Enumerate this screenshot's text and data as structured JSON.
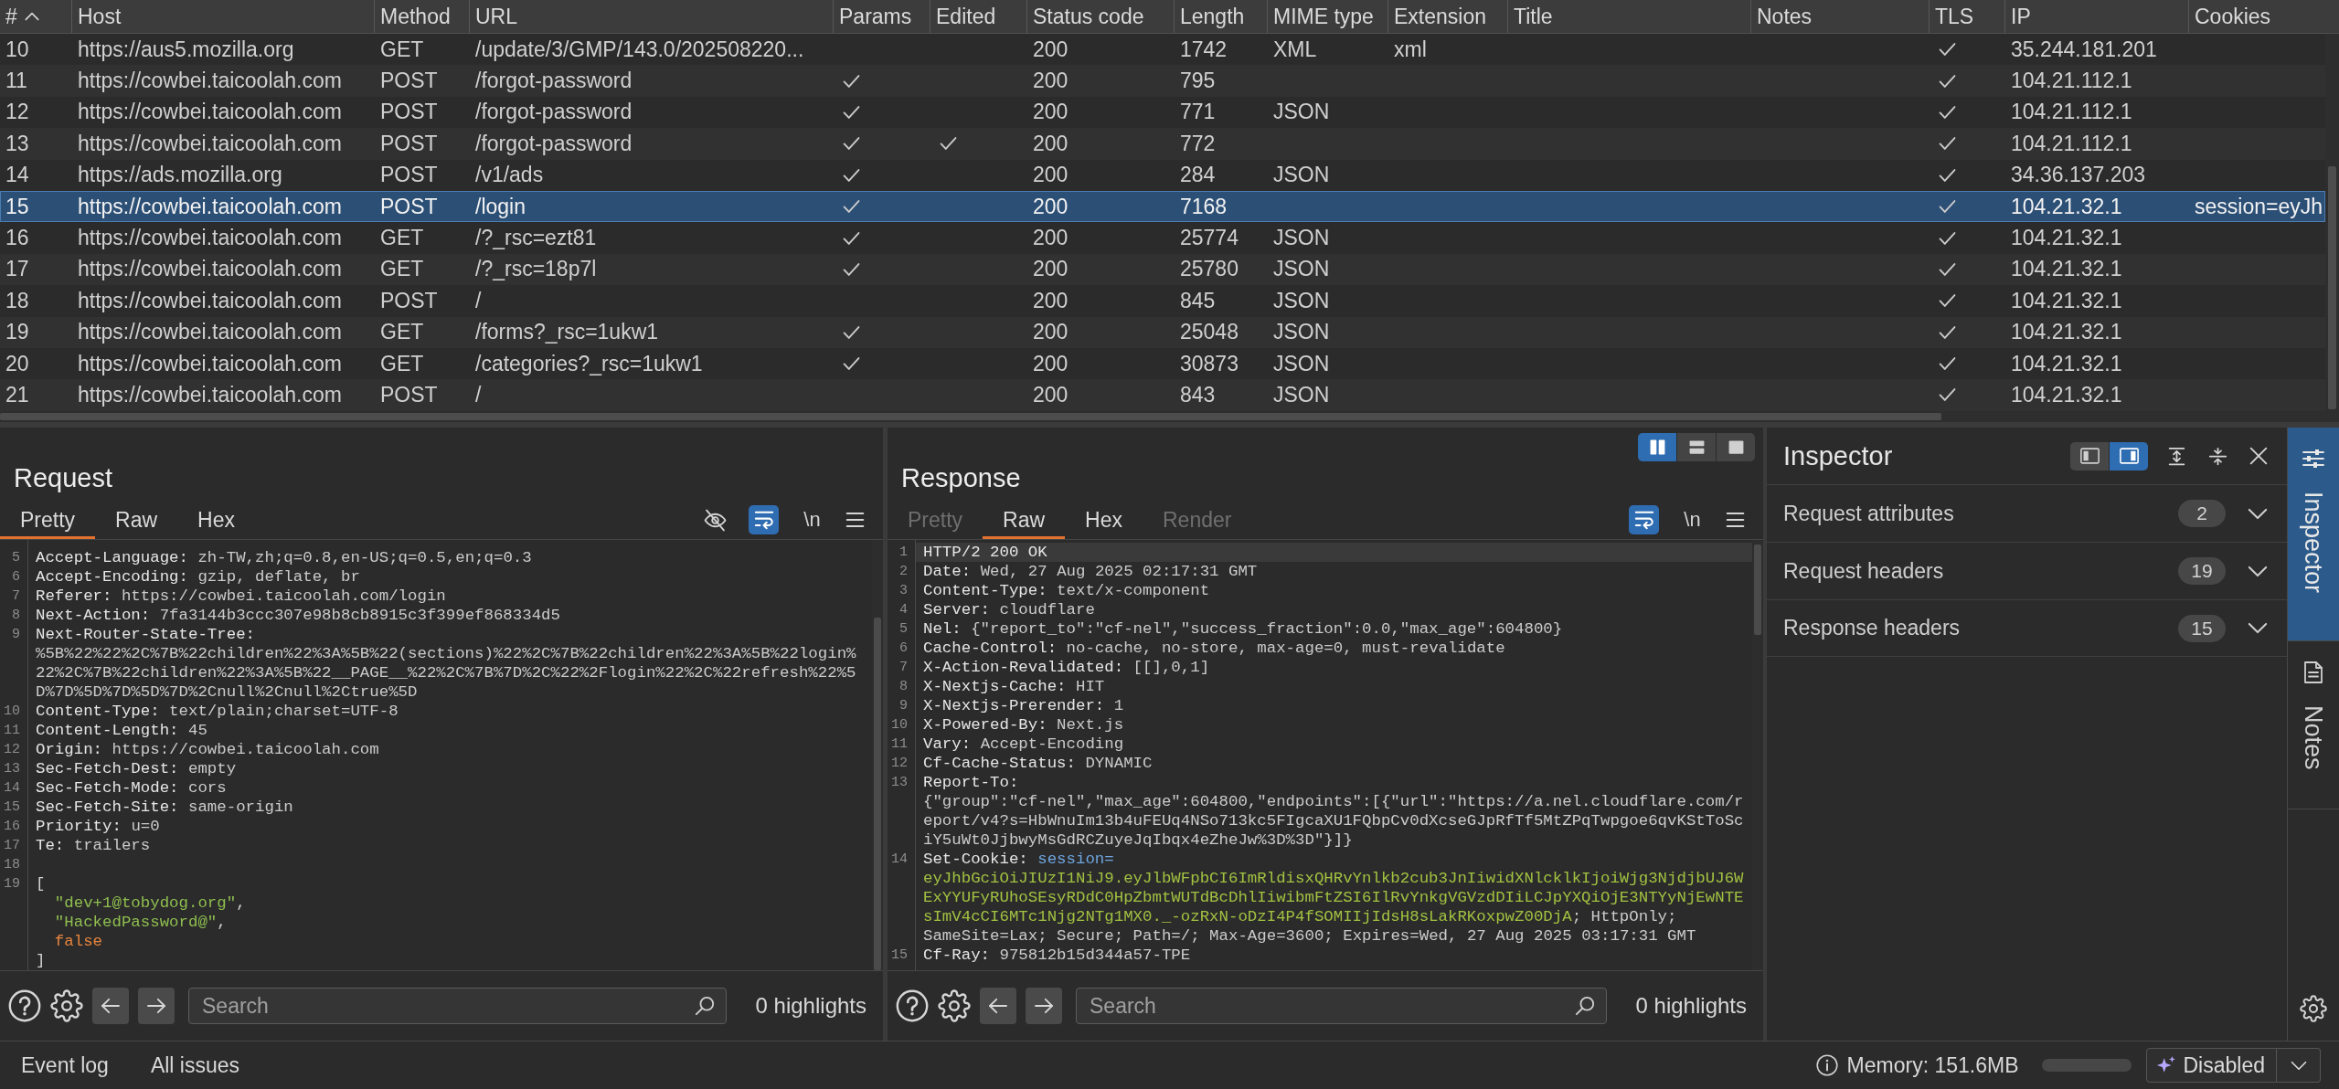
{
  "table": {
    "columns": [
      {
        "label": "#",
        "sorted": true
      },
      {
        "label": "Host",
        "sorted": false
      },
      {
        "label": "Method",
        "sorted": false
      },
      {
        "label": "URL",
        "sorted": false
      },
      {
        "label": "Params",
        "sorted": false
      },
      {
        "label": "Edited",
        "sorted": false
      },
      {
        "label": "Status code",
        "sorted": false
      },
      {
        "label": "Length",
        "sorted": false
      },
      {
        "label": "MIME type",
        "sorted": false
      },
      {
        "label": "Extension",
        "sorted": false
      },
      {
        "label": "Title",
        "sorted": false
      },
      {
        "label": "Notes",
        "sorted": false
      },
      {
        "label": "TLS",
        "sorted": false
      },
      {
        "label": "IP",
        "sorted": false
      },
      {
        "label": "Cookies",
        "sorted": false
      }
    ],
    "rows": [
      {
        "number": "10",
        "host": "https://aus5.mozilla.org",
        "method": "GET",
        "url": "/update/3/GMP/143.0/202508220...",
        "params": false,
        "edited": false,
        "status_code": "200",
        "length": "1742",
        "mime_type": "XML",
        "extension": "xml",
        "tls": true,
        "ip": "35.244.181.201",
        "selected": false
      },
      {
        "number": "11",
        "host": "https://cowbei.taicoolah.com",
        "method": "POST",
        "url": "/forgot-password",
        "params": true,
        "edited": false,
        "status_code": "200",
        "length": "795",
        "tls": true,
        "ip": "104.21.112.1",
        "selected": false
      },
      {
        "number": "12",
        "host": "https://cowbei.taicoolah.com",
        "method": "POST",
        "url": "/forgot-password",
        "params": true,
        "edited": false,
        "status_code": "200",
        "length": "771",
        "mime_type": "JSON",
        "tls": true,
        "ip": "104.21.112.1",
        "selected": false
      },
      {
        "number": "13",
        "host": "https://cowbei.taicoolah.com",
        "method": "POST",
        "url": "/forgot-password",
        "params": true,
        "edited": true,
        "status_code": "200",
        "length": "772",
        "tls": true,
        "ip": "104.21.112.1",
        "selected": false
      },
      {
        "number": "14",
        "host": "https://ads.mozilla.org",
        "method": "POST",
        "url": "/v1/ads",
        "params": true,
        "edited": false,
        "status_code": "200",
        "length": "284",
        "mime_type": "JSON",
        "tls": true,
        "ip": "34.36.137.203",
        "selected": false
      },
      {
        "number": "15",
        "host": "https://cowbei.taicoolah.com",
        "method": "POST",
        "url": "/login",
        "params": true,
        "edited": false,
        "status_code": "200",
        "length": "7168",
        "tls": true,
        "ip": "104.21.32.1",
        "cookies": "session=eyJh",
        "selected": true
      },
      {
        "number": "16",
        "host": "https://cowbei.taicoolah.com",
        "method": "GET",
        "url": "/?_rsc=ezt81",
        "params": true,
        "edited": false,
        "status_code": "200",
        "length": "25774",
        "mime_type": "JSON",
        "tls": true,
        "ip": "104.21.32.1",
        "selected": false
      },
      {
        "number": "17",
        "host": "https://cowbei.taicoolah.com",
        "method": "GET",
        "url": "/?_rsc=18p7l",
        "params": true,
        "edited": false,
        "status_code": "200",
        "length": "25780",
        "mime_type": "JSON",
        "tls": true,
        "ip": "104.21.32.1",
        "selected": false
      },
      {
        "number": "18",
        "host": "https://cowbei.taicoolah.com",
        "method": "POST",
        "url": "/",
        "params": false,
        "edited": false,
        "status_code": "200",
        "length": "845",
        "mime_type": "JSON",
        "tls": true,
        "ip": "104.21.32.1",
        "selected": false
      },
      {
        "number": "19",
        "host": "https://cowbei.taicoolah.com",
        "method": "GET",
        "url": "/forms?_rsc=1ukw1",
        "params": true,
        "edited": false,
        "status_code": "200",
        "length": "25048",
        "mime_type": "JSON",
        "tls": true,
        "ip": "104.21.32.1",
        "selected": false
      },
      {
        "number": "20",
        "host": "https://cowbei.taicoolah.com",
        "method": "GET",
        "url": "/categories?_rsc=1ukw1",
        "params": true,
        "edited": false,
        "status_code": "200",
        "length": "30873",
        "mime_type": "JSON",
        "tls": true,
        "ip": "104.21.32.1",
        "selected": false
      },
      {
        "number": "21",
        "host": "https://cowbei.taicoolah.com",
        "method": "POST",
        "url": "/",
        "params": false,
        "edited": false,
        "status_code": "200",
        "length": "843",
        "mime_type": "JSON",
        "tls": true,
        "ip": "104.21.32.1",
        "selected": false
      }
    ]
  },
  "request": {
    "title": "Request",
    "tabs": [
      {
        "label": "Pretty",
        "selected": true,
        "disabled": false
      },
      {
        "label": "Raw",
        "selected": false,
        "disabled": false
      },
      {
        "label": "Hex",
        "selected": false,
        "disabled": false
      }
    ],
    "tools": [
      {
        "kind": "hide",
        "on": false
      },
      {
        "kind": "wrap",
        "on": true
      },
      {
        "kind": "newline",
        "label": "\\n",
        "on": false
      },
      {
        "kind": "menu"
      }
    ],
    "lines": [
      {
        "number": "5",
        "kind": "header",
        "current": false,
        "parts": [
          {
            "kind": "name",
            "text": "Accept-Language:"
          },
          {
            "kind": "value",
            "text": "zh-TW,zh;q=0.8,en-US;q=0.5,en;q=0.3"
          }
        ]
      },
      {
        "number": "6",
        "kind": "header",
        "current": false,
        "parts": [
          {
            "kind": "name",
            "text": "Accept-Encoding:"
          },
          {
            "kind": "value",
            "text": "gzip, deflate, br"
          }
        ]
      },
      {
        "number": "7",
        "kind": "header",
        "current": false,
        "parts": [
          {
            "kind": "name",
            "text": "Referer:"
          },
          {
            "kind": "value",
            "text": "https://cowbei.taicoolah.com/login"
          }
        ]
      },
      {
        "number": "8",
        "kind": "header",
        "current": false,
        "parts": [
          {
            "kind": "name",
            "text": "Next-Action:"
          },
          {
            "kind": "value",
            "text": "7fa3144b3ccc307e98b8cb8915c3f399ef868334d5"
          }
        ]
      },
      {
        "number": "9",
        "kind": "header",
        "current": false,
        "parts": [
          {
            "kind": "name",
            "text": "Next-Router-State-Tree:"
          },
          {
            "kind": "value",
            "text": "%5B%22%22%2C%7B%22children%22%3A%5B%22(sections)%22%2C%7B%22children%22%3A%5B%22login%22%2C%7B%22children%22%3A%5B%22__PAGE__%22%2C%7B%7D%2C%22%2Flogin%22%2C%22refresh%22%5D%7D%5D%7D%5D%7D%2Cnull%2Cnull%2Ctrue%5D"
          }
        ]
      },
      {
        "number": "10",
        "kind": "header",
        "current": false,
        "parts": [
          {
            "kind": "name",
            "text": "Content-Type:"
          },
          {
            "kind": "value",
            "text": "text/plain;charset=UTF-8"
          }
        ]
      },
      {
        "number": "11",
        "kind": "header",
        "current": false,
        "parts": [
          {
            "kind": "name",
            "text": "Content-Length:"
          },
          {
            "kind": "value",
            "text": "45"
          }
        ]
      },
      {
        "number": "12",
        "kind": "header",
        "current": false,
        "parts": [
          {
            "kind": "name",
            "text": "Origin:"
          },
          {
            "kind": "value",
            "text": "https://cowbei.taicoolah.com"
          }
        ]
      },
      {
        "number": "13",
        "kind": "header",
        "current": false,
        "parts": [
          {
            "kind": "name",
            "text": "Sec-Fetch-Dest:"
          },
          {
            "kind": "value",
            "text": "empty"
          }
        ]
      },
      {
        "number": "14",
        "kind": "header",
        "current": false,
        "parts": [
          {
            "kind": "name",
            "text": "Sec-Fetch-Mode:"
          },
          {
            "kind": "value",
            "text": "cors"
          }
        ]
      },
      {
        "number": "15",
        "kind": "header",
        "current": false,
        "parts": [
          {
            "kind": "name",
            "text": "Sec-Fetch-Site:"
          },
          {
            "kind": "value",
            "text": "same-origin"
          }
        ]
      },
      {
        "number": "16",
        "kind": "header",
        "current": false,
        "parts": [
          {
            "kind": "name",
            "text": "Priority:"
          },
          {
            "kind": "value",
            "text": "u=0"
          }
        ]
      },
      {
        "number": "17",
        "kind": "header",
        "current": false,
        "parts": [
          {
            "kind": "name",
            "text": "Te:"
          },
          {
            "kind": "value",
            "text": "trailers"
          }
        ]
      },
      {
        "number": "18",
        "kind": "blank",
        "current": false
      },
      {
        "number": "19",
        "kind": "json",
        "current": false,
        "open": "[",
        "items": [
          {
            "kind": "string",
            "text": "\"dev+1@tobydog.org\"",
            "comma": ","
          },
          {
            "kind": "string",
            "text": "\"HackedPassword@\"",
            "comma": ","
          },
          {
            "kind": "literal",
            "text": "false"
          }
        ],
        "close": "]"
      }
    ],
    "footer": {
      "search": {
        "placeholder": "Search"
      },
      "highlights": "0 highlights"
    }
  },
  "response": {
    "title": "Response",
    "views": [
      {
        "kind": "columns",
        "selected": true
      },
      {
        "kind": "rows",
        "selected": false
      },
      {
        "kind": "single",
        "selected": false
      }
    ],
    "tabs": [
      {
        "label": "Pretty",
        "selected": false,
        "disabled": true
      },
      {
        "label": "Raw",
        "selected": true,
        "disabled": false
      },
      {
        "label": "Hex",
        "selected": false,
        "disabled": false
      },
      {
        "label": "Render",
        "selected": false,
        "disabled": true
      }
    ],
    "tools": [
      {
        "kind": "wrap",
        "on": true
      },
      {
        "kind": "newline",
        "label": "\\n",
        "on": false
      },
      {
        "kind": "menu"
      }
    ],
    "lines": [
      {
        "number": "1",
        "kind": "header",
        "current": true,
        "parts": [
          {
            "kind": "status",
            "text": "HTTP/2 200 OK"
          }
        ]
      },
      {
        "number": "2",
        "kind": "header",
        "current": false,
        "parts": [
          {
            "kind": "name",
            "text": "Date:"
          },
          {
            "kind": "value",
            "text": "Wed, 27 Aug 2025 02:17:31 GMT"
          }
        ]
      },
      {
        "number": "3",
        "kind": "header",
        "current": false,
        "parts": [
          {
            "kind": "name",
            "text": "Content-Type:"
          },
          {
            "kind": "value",
            "text": "text/x-component"
          }
        ]
      },
      {
        "number": "4",
        "kind": "header",
        "current": false,
        "parts": [
          {
            "kind": "name",
            "text": "Server:"
          },
          {
            "kind": "value",
            "text": "cloudflare"
          }
        ]
      },
      {
        "number": "5",
        "kind": "header",
        "current": false,
        "parts": [
          {
            "kind": "name",
            "text": "Nel:"
          },
          {
            "kind": "value",
            "text": "{\"report_to\":\"cf-nel\",\"success_fraction\":0.0,\"max_age\":604800}"
          }
        ]
      },
      {
        "number": "6",
        "kind": "header",
        "current": false,
        "parts": [
          {
            "kind": "name",
            "text": "Cache-Control:"
          },
          {
            "kind": "value",
            "text": "no-cache, no-store, max-age=0, must-revalidate"
          }
        ]
      },
      {
        "number": "7",
        "kind": "header",
        "current": false,
        "parts": [
          {
            "kind": "name",
            "text": "X-Action-Revalidated:"
          },
          {
            "kind": "value",
            "text": "[[],0,1]"
          }
        ]
      },
      {
        "number": "8",
        "kind": "header",
        "current": false,
        "parts": [
          {
            "kind": "name",
            "text": "X-Nextjs-Cache:"
          },
          {
            "kind": "value",
            "text": "HIT"
          }
        ]
      },
      {
        "number": "9",
        "kind": "header",
        "current": false,
        "parts": [
          {
            "kind": "name",
            "text": "X-Nextjs-Prerender:"
          },
          {
            "kind": "value",
            "text": "1"
          }
        ]
      },
      {
        "number": "10",
        "kind": "header",
        "current": false,
        "parts": [
          {
            "kind": "name",
            "text": "X-Powered-By:"
          },
          {
            "kind": "value",
            "text": "Next.js"
          }
        ]
      },
      {
        "number": "11",
        "kind": "header",
        "current": false,
        "parts": [
          {
            "kind": "name",
            "text": "Vary:"
          },
          {
            "kind": "value",
            "text": "Accept-Encoding"
          }
        ]
      },
      {
        "number": "12",
        "kind": "header",
        "current": false,
        "parts": [
          {
            "kind": "name",
            "text": "Cf-Cache-Status:"
          },
          {
            "kind": "value",
            "text": "DYNAMIC"
          }
        ]
      },
      {
        "number": "13",
        "kind": "header",
        "current": false,
        "parts": [
          {
            "kind": "name",
            "text": "Report-To:"
          },
          {
            "kind": "value",
            "text": "{\"group\":\"cf-nel\",\"max_age\":604800,\"endpoints\":[{\"url\":\"https://a.nel.cloudflare.com/report/v4?s=HbWnuIm13b4uFEUq4NSo713kc5FIgcaXU1FQbpCv0dXcseGJpRfTf5MtZPqTwpgoe6qvKStToSciY5uWt0JjbwyMsGdRCZuyeJqIbqx4eZheJw%3D%3D\"}]}"
          }
        ]
      },
      {
        "number": "14",
        "kind": "header",
        "current": false,
        "parts": [
          {
            "kind": "name",
            "text": "Set-Cookie:"
          },
          {
            "kind": "cookie-name",
            "text": "session="
          },
          {
            "kind": "cookie-value",
            "text": "eyJhbGciOiJIUzI1NiJ9.eyJlbWFpbCI6ImRldisxQHRvYnlkb2cub3JnIiwidXNlcklkIjoiWjg3NjdjbUJ6WExYYUFyRUhoSEsyRDdC0HpZbmtWUTdBcDhlIiwibmFtZSI6IlRvYnkgVGVzdDIiLCJpYXQiOjE3NTYyNjEwNTEsImV4cCI6MTc1Njg2NTg1MX0._-ozRxN-oDzI4P4fSOMIIjIdsH8sLakRKoxpwZ00DjA"
          },
          {
            "kind": "cookie-attrs",
            "text": "; HttpOnly; SameSite=Lax; Secure; Path=/; Max-Age=3600; Expires=Wed, 27 Aug 2025 03:17:31 GMT"
          }
        ]
      },
      {
        "number": "15",
        "kind": "header",
        "current": false,
        "parts": [
          {
            "kind": "name",
            "text": "Cf-Ray:"
          },
          {
            "kind": "value",
            "text": "975812b15d344a57-TPE"
          }
        ]
      }
    ],
    "footer": {
      "search": {
        "placeholder": "Search"
      },
      "highlights": "0 highlights"
    }
  },
  "inspector": {
    "title": "Inspector",
    "layouts": [
      {
        "kind": "left",
        "selected": false
      },
      {
        "kind": "right",
        "selected": true
      }
    ],
    "sections": [
      {
        "label": "Request attributes",
        "count": "2",
        "expanded": false
      },
      {
        "label": "Request headers",
        "count": "19",
        "expanded": false
      },
      {
        "label": "Response headers",
        "count": "15",
        "expanded": false
      }
    ]
  },
  "side_tabs": [
    {
      "kind": "inspector",
      "label": "Inspector",
      "selected": true
    },
    {
      "kind": "notes",
      "label": "Notes",
      "selected": false
    }
  ],
  "status_bar": {
    "tabs": [
      {
        "label": "Event log"
      },
      {
        "label": "All issues"
      }
    ],
    "memory": {
      "label": "Memory: 151.6MB",
      "level": 0
    },
    "ai_button": {
      "label": "Disabled"
    }
  }
}
